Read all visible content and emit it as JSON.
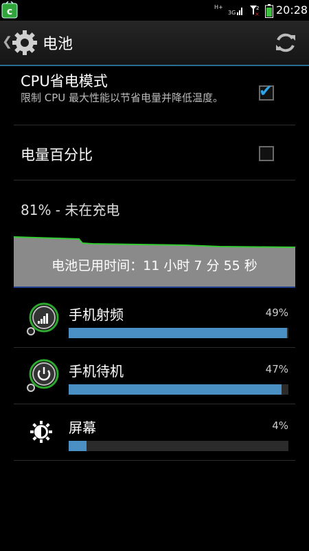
{
  "status_bar": {
    "time": "20:28",
    "network_type": "3G",
    "network_arrows": "H+"
  },
  "action_bar": {
    "title": "电池",
    "back_glyph": "❮"
  },
  "settings": {
    "cpu_saver": {
      "title": "CPU省电模式",
      "summary": "限制 CPU 最大性能以节省电量并降低温度。",
      "checked": true
    },
    "battery_percentage": {
      "title": "电量百分比",
      "checked": false
    }
  },
  "battery_status": "81% - 未在充电",
  "graph": {
    "label": "电池已用时间：11 小时 7 分 55 秒",
    "line_color": "#33cc33"
  },
  "usage": [
    {
      "name": "手机射频",
      "percent_label": "49%",
      "fraction": 0.995,
      "icon": "signal-icon"
    },
    {
      "name": "手机待机",
      "percent_label": "47%",
      "fraction": 0.97,
      "icon": "power-icon"
    },
    {
      "name": "屏幕",
      "percent_label": "4%",
      "fraction": 0.08,
      "icon": "brightness-icon"
    }
  ],
  "colors": {
    "accent": "#4a90c4",
    "check": "#2ea5e8",
    "divider": "#2a6f95"
  }
}
